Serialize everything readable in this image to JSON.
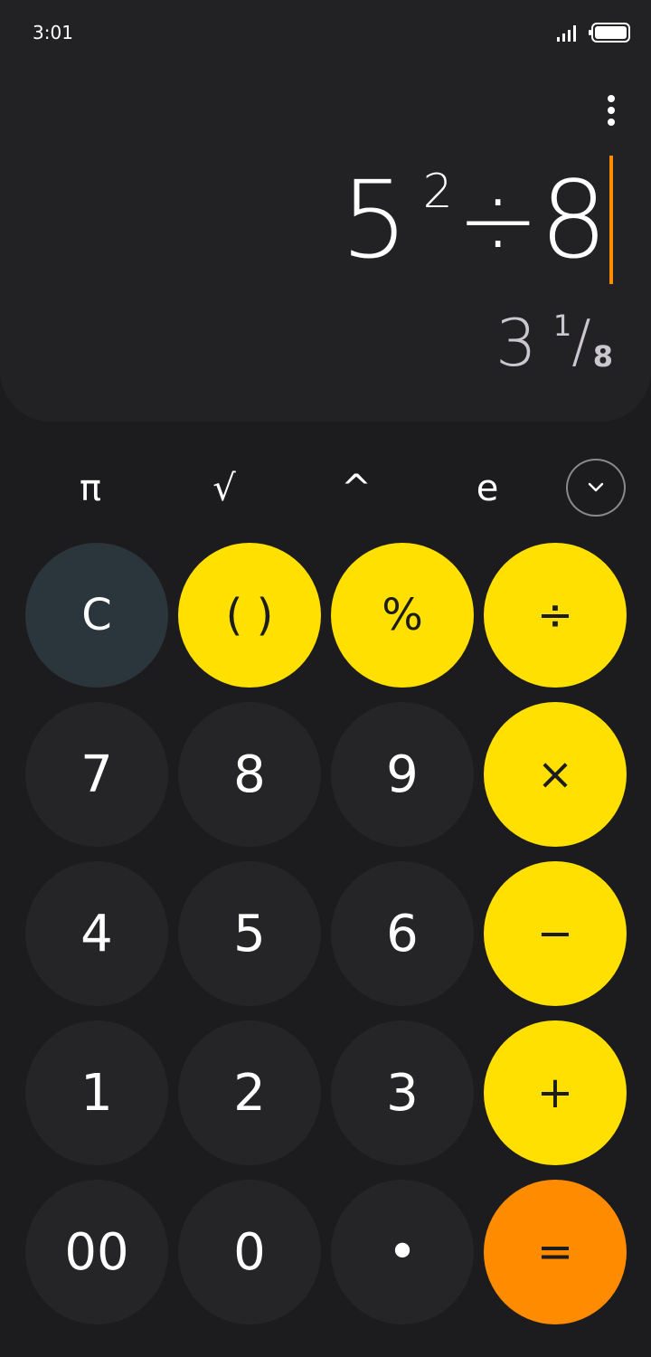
{
  "status_bar": {
    "time": "3:01"
  },
  "display": {
    "expression": {
      "base": "5",
      "exponent": "2",
      "operator": "÷",
      "operand": "8"
    },
    "result": {
      "whole": "3",
      "numerator": "1",
      "slash": "/",
      "denominator": "8"
    }
  },
  "scientific": {
    "pi": "π",
    "sqrt": "√",
    "power": "^",
    "e": "e"
  },
  "keys": {
    "clear": "C",
    "parens": "( )",
    "percent": "%",
    "divide": "÷",
    "seven": "7",
    "eight": "8",
    "nine": "9",
    "multiply": "×",
    "four": "4",
    "five": "5",
    "six": "6",
    "minus": "−",
    "one": "1",
    "two": "2",
    "three": "3",
    "plus": "+",
    "double_zero": "00",
    "zero": "0",
    "decimal": "•",
    "equals": "="
  },
  "colors": {
    "operator_key": "#ffe000",
    "equals_key": "#ff8c00",
    "clear_key": "#2a353c",
    "number_key": "#252527",
    "cursor": "#ff8c00"
  }
}
